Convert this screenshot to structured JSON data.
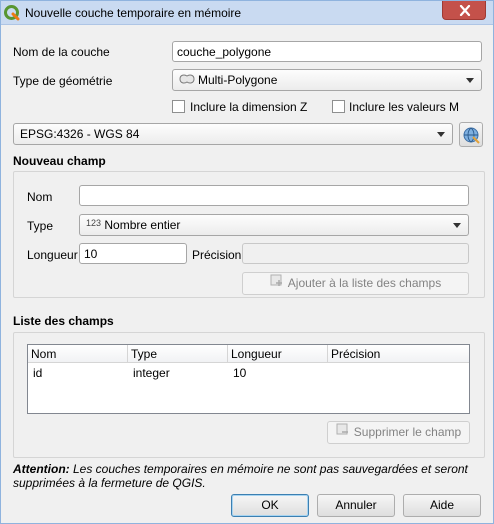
{
  "window": {
    "title": "Nouvelle couche temporaire en mémoire"
  },
  "layer": {
    "name_label": "Nom de la couche",
    "name_value": "couche_polygone",
    "geometry_label": "Type de géométrie",
    "geometry_value": "Multi-Polygone",
    "include_z_label": "Inclure la dimension Z",
    "include_m_label": "Inclure les valeurs M",
    "crs_value": "EPSG:4326 - WGS 84"
  },
  "new_field": {
    "section_title": "Nouveau champ",
    "name_label": "Nom",
    "name_value": "",
    "type_label": "Type",
    "type_prefix": "123",
    "type_value": "Nombre entier",
    "length_label": "Longueur",
    "length_value": "10",
    "precision_label": "Précision",
    "precision_value": "",
    "add_button_label": "Ajouter à la liste des champs"
  },
  "fields_list": {
    "section_title": "Liste des champs",
    "columns": [
      "Nom",
      "Type",
      "Longueur",
      "Précision"
    ],
    "rows": [
      [
        "id",
        "integer",
        "10",
        ""
      ]
    ],
    "remove_button_label": "Supprimer le champ"
  },
  "footer": {
    "attention_label": "Attention:",
    "attention_text": " Les couches temporaires en mémoire ne sont pas sauvegardées et seront supprimées à la fermeture de QGIS."
  },
  "buttons": {
    "ok": "OK",
    "cancel": "Annuler",
    "help": "Aide"
  },
  "icons": {
    "app": "qgis-icon",
    "close": "close-icon",
    "polygon": "polygon-icon",
    "crs": "crs-globe-icon",
    "add_field": "add-field-icon",
    "remove_field": "remove-field-icon"
  }
}
